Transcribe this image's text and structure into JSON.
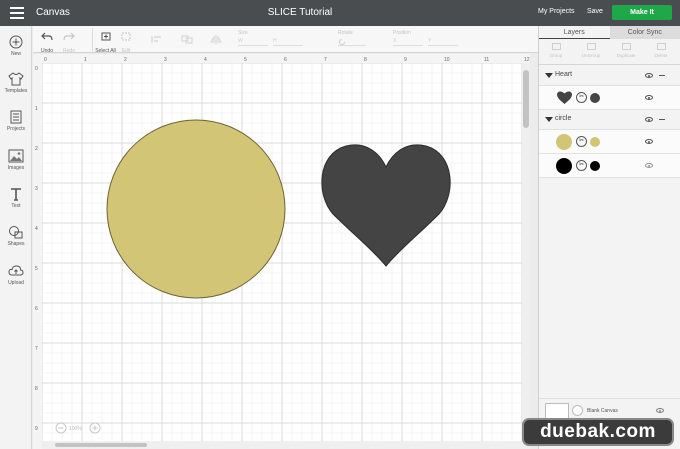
{
  "topbar": {
    "app_title": "Canvas",
    "doc_title": "SLICE Tutorial",
    "my_projects": "My Projects",
    "save": "Save",
    "make_it": "Make It"
  },
  "sidebar": {
    "items": [
      {
        "label": "New",
        "icon": "plus-icon"
      },
      {
        "label": "Templates",
        "icon": "shirt-icon"
      },
      {
        "label": "Projects",
        "icon": "projects-icon"
      },
      {
        "label": "Images",
        "icon": "image-icon"
      },
      {
        "label": "Text",
        "icon": "text-icon"
      },
      {
        "label": "Shapes",
        "icon": "shapes-icon"
      },
      {
        "label": "Upload",
        "icon": "cloud-upload-icon"
      }
    ]
  },
  "toolbar": {
    "undo": "Undo",
    "redo": "Redo",
    "select_all": "Select All",
    "edit": "Edit",
    "size": "Size",
    "rotate": "Rotate",
    "position": "Position",
    "w": "W",
    "h": "H",
    "x": "X",
    "y": "Y"
  },
  "canvas": {
    "ruler_top": [
      "0",
      "1",
      "2",
      "3",
      "4",
      "5",
      "6",
      "7",
      "8",
      "9",
      "10",
      "11",
      "12"
    ],
    "ruler_left": [
      "0",
      "1",
      "2",
      "3",
      "4",
      "5",
      "6",
      "7",
      "8",
      "9"
    ],
    "zoom": "100%",
    "shapes": [
      {
        "name": "circle",
        "color": "#d2c575",
        "stroke": "#6d6335"
      },
      {
        "name": "heart",
        "color": "#444444",
        "stroke": "#2b2b2b"
      }
    ]
  },
  "right_panel": {
    "tabs": [
      "Layers",
      "Color Sync"
    ],
    "active_tab": "Layers",
    "layer_tools": [
      "Group",
      "UnGroup",
      "Duplicate",
      "Delete"
    ],
    "groups": [
      {
        "name": "Heart",
        "rows": [
          {
            "color": "#444444"
          }
        ]
      },
      {
        "name": "circle",
        "rows": [
          {
            "color": "#d2c575"
          },
          {
            "color": "#000000"
          }
        ]
      }
    ],
    "blank_canvas": "Blank Canvas"
  },
  "watermark": "duebak.com",
  "colors": {
    "topbar": "#4a4d50",
    "make_it": "#1fa84a"
  }
}
